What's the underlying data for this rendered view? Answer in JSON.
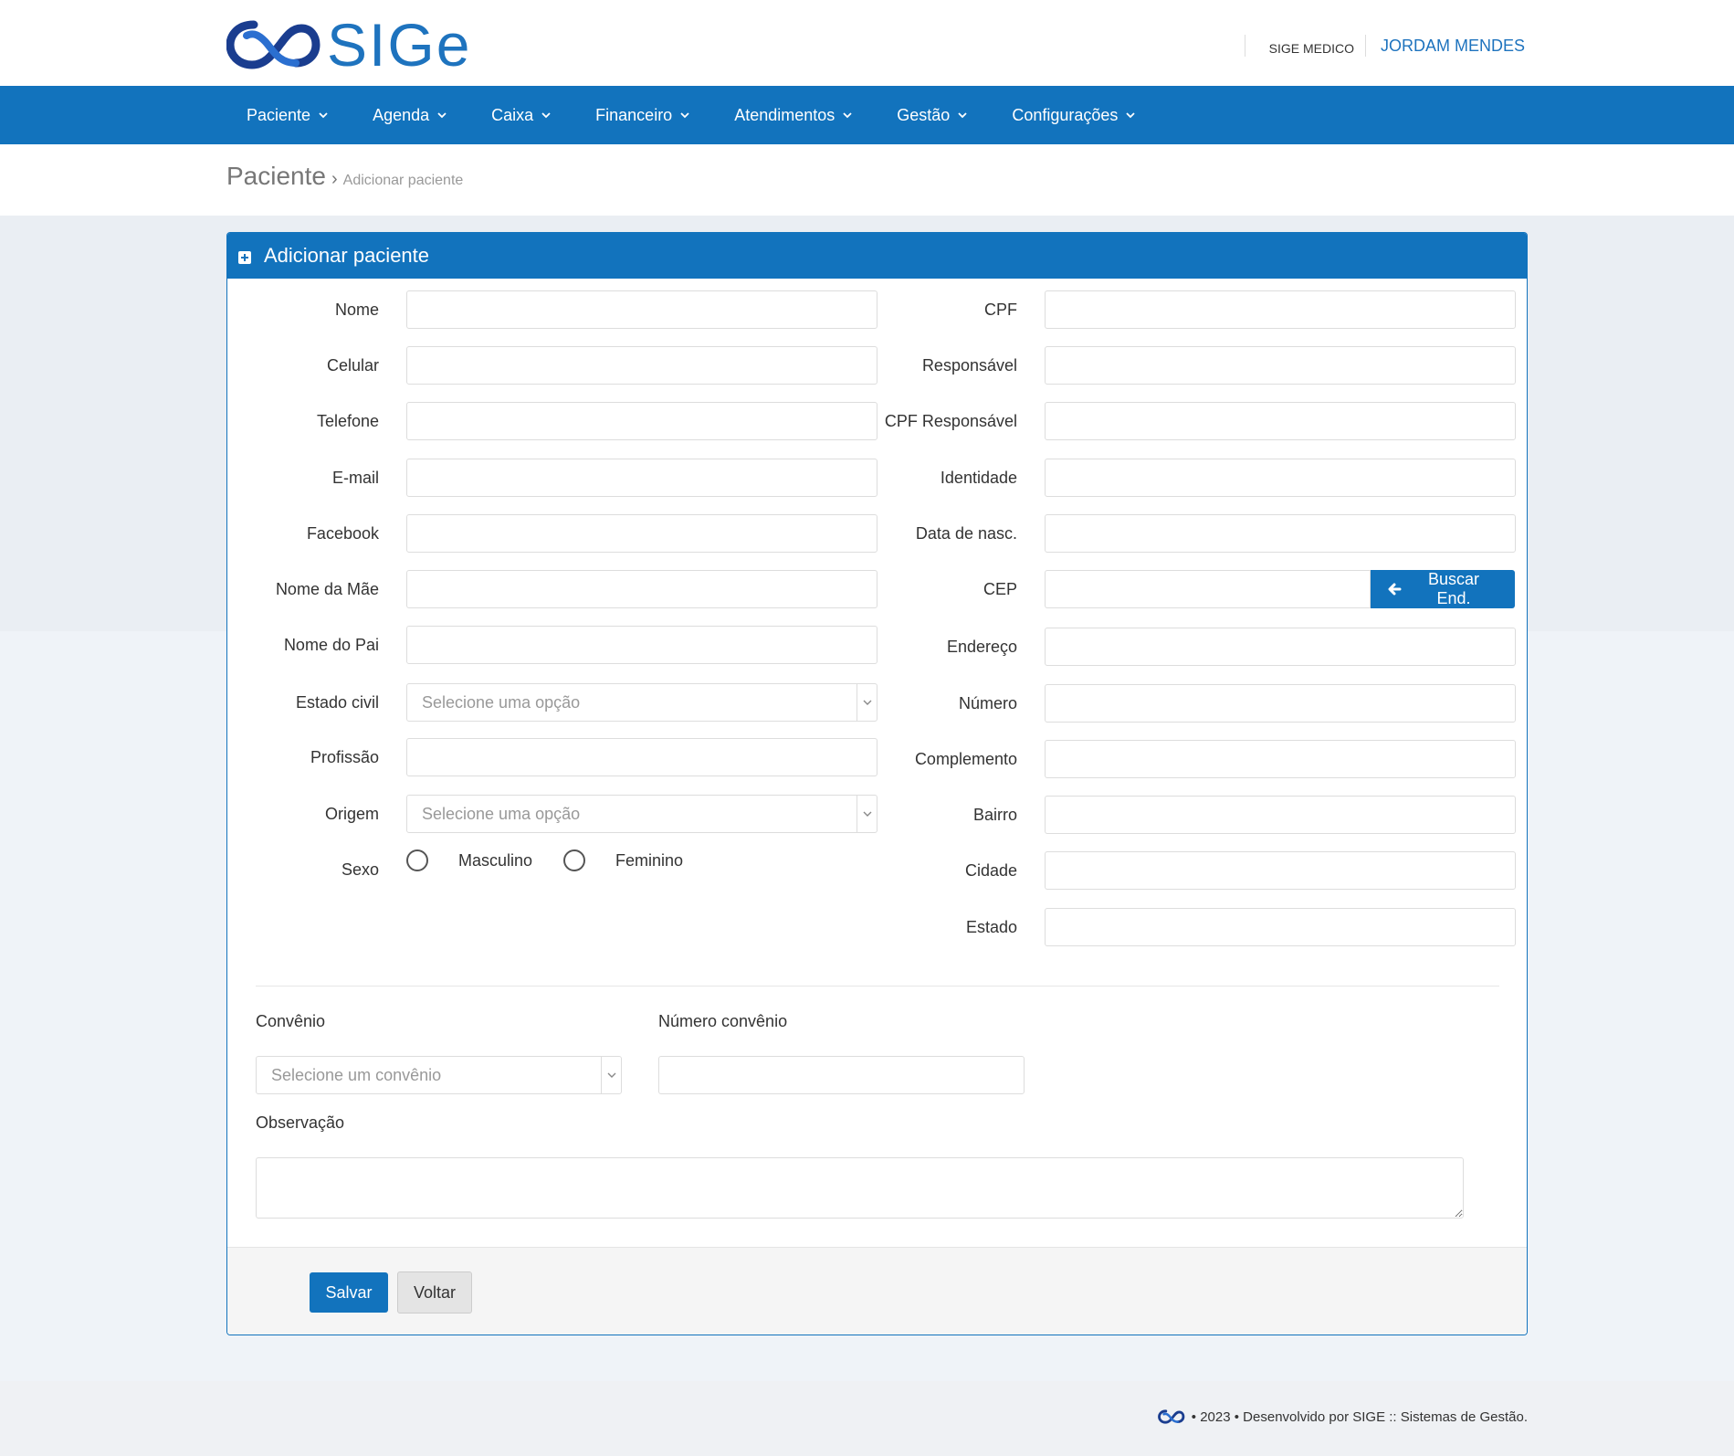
{
  "header": {
    "logo_text": "SIGe",
    "company": "SIGE MEDICO",
    "user": "JORDAM MENDES"
  },
  "nav": {
    "items": [
      {
        "label": "Paciente"
      },
      {
        "label": "Agenda"
      },
      {
        "label": "Caixa"
      },
      {
        "label": "Financeiro"
      },
      {
        "label": "Atendimentos"
      },
      {
        "label": "Gestão"
      },
      {
        "label": "Configurações"
      }
    ]
  },
  "breadcrumb": {
    "title": "Paciente",
    "separator": "›",
    "sub": "Adicionar paciente"
  },
  "panel": {
    "title": "Adicionar paciente"
  },
  "form": {
    "left": {
      "nome": "Nome",
      "celular": "Celular",
      "telefone": "Telefone",
      "email": "E-mail",
      "facebook": "Facebook",
      "nome_mae": "Nome da Mãe",
      "nome_pai": "Nome do Pai",
      "estado_civil": "Estado civil",
      "estado_civil_placeholder": "Selecione uma opção",
      "profissao": "Profissão",
      "origem": "Origem",
      "origem_placeholder": "Selecione uma opção",
      "sexo": "Sexo",
      "masculino": "Masculino",
      "feminino": "Feminino"
    },
    "right": {
      "cpf": "CPF",
      "responsavel": "Responsável",
      "cpf_responsavel": "CPF Responsável",
      "identidade": "Identidade",
      "data_nasc": "Data de nasc.",
      "cep": "CEP",
      "buscar": "Buscar End.",
      "endereco": "Endereço",
      "numero": "Número",
      "complemento": "Complemento",
      "bairro": "Bairro",
      "cidade": "Cidade",
      "estado": "Estado"
    },
    "convenio": "Convênio",
    "convenio_placeholder": "Selecione um convênio",
    "numero_convenio": "Número convênio",
    "observacao": "Observação"
  },
  "actions": {
    "salvar": "Salvar",
    "voltar": "Voltar"
  },
  "footer": {
    "text": "• 2023 • Desenvolvido por SIGE :: Sistemas de Gestão."
  },
  "colors": {
    "primary": "#1273bd",
    "link": "#1e73be"
  }
}
